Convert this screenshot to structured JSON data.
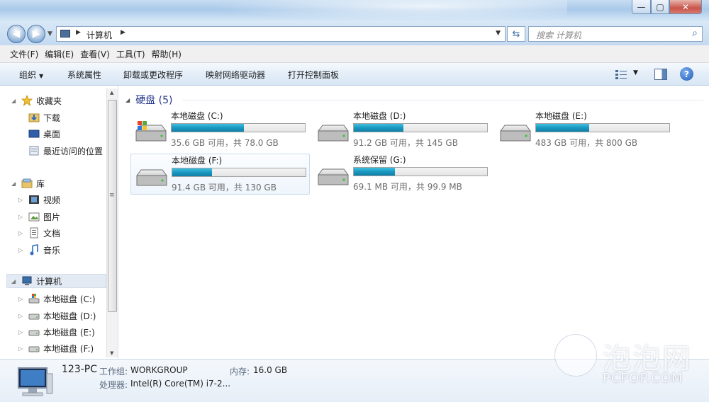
{
  "window": {
    "title_controls": {
      "minimize": "—",
      "maximize": "▢",
      "close": "✕"
    }
  },
  "address": {
    "crumb": "计算机",
    "search_placeholder": "搜索 计算机"
  },
  "menu": [
    "文件(F)",
    "编辑(E)",
    "查看(V)",
    "工具(T)",
    "帮助(H)"
  ],
  "commands": {
    "organize": "组织",
    "system_properties": "系统属性",
    "uninstall": "卸载或更改程序",
    "map_drive": "映射网络驱动器",
    "control_panel": "打开控制面板"
  },
  "nav": {
    "favorites": "收藏夹",
    "downloads": "下载",
    "desktop": "桌面",
    "recent": "最近访问的位置",
    "libraries": "库",
    "videos": "视频",
    "pictures": "图片",
    "documents": "文档",
    "music": "音乐",
    "computer": "计算机",
    "drive_c": "本地磁盘 (C:)",
    "drive_d": "本地磁盘 (D:)",
    "drive_e": "本地磁盘 (E:)",
    "drive_f": "本地磁盘 (F:)"
  },
  "content": {
    "group_title": "硬盘 (5)",
    "drives": [
      {
        "name": "本地磁盘 (C:)",
        "free": "35.6 GB 可用，共 78.0 GB",
        "used_fraction": 0.54,
        "system": true
      },
      {
        "name": "本地磁盘 (D:)",
        "free": "91.2 GB 可用，共 145 GB",
        "used_fraction": 0.37,
        "system": false
      },
      {
        "name": "本地磁盘 (E:)",
        "free": "483 GB 可用，共 800 GB",
        "used_fraction": 0.4,
        "system": false
      },
      {
        "name": "本地磁盘 (F:)",
        "free": "91.4 GB 可用，共 130 GB",
        "used_fraction": 0.3,
        "system": false
      },
      {
        "name": "系统保留 (G:)",
        "free": "69.1 MB 可用，共 99.9 MB",
        "used_fraction": 0.31,
        "system": false
      }
    ]
  },
  "details": {
    "pc_name": "123-PC",
    "workgroup_label": "工作组:",
    "workgroup": "WORKGROUP",
    "memory_label": "内存:",
    "memory": "16.0 GB",
    "cpu_label": "处理器:",
    "cpu": "Intel(R) Core(TM) i7-2..."
  },
  "watermark": {
    "text": "泡泡网",
    "url": "PCPOP.COM"
  },
  "colors": {
    "accent": "#1a98c0",
    "group_title": "#1e3287"
  }
}
